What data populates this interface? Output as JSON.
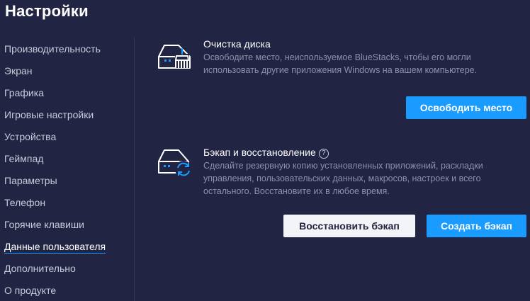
{
  "page_title": "Настройки",
  "sidebar": {
    "items": [
      {
        "label": "Производительность",
        "active": false
      },
      {
        "label": "Экран",
        "active": false
      },
      {
        "label": "Графика",
        "active": false
      },
      {
        "label": "Игровые настройки",
        "active": false
      },
      {
        "label": "Устройства",
        "active": false
      },
      {
        "label": "Геймпад",
        "active": false
      },
      {
        "label": "Параметры",
        "active": false
      },
      {
        "label": "Телефон",
        "active": false
      },
      {
        "label": "Горячие клавиши",
        "active": false
      },
      {
        "label": "Данные пользователя",
        "active": true
      },
      {
        "label": "Дополнительно",
        "active": false
      },
      {
        "label": "О продукте",
        "active": false
      }
    ]
  },
  "disk_cleanup": {
    "icon": "disk-cleanup-icon",
    "title": "Очистка диска",
    "description": "Освободите место, неиспользуемое BlueStacks, чтобы его могли использовать другие приложения Windows на вашем компьютере.",
    "button_label": "Освободить место"
  },
  "backup": {
    "icon": "backup-restore-icon",
    "title": "Бэкап и восстановление",
    "help_glyph": "?",
    "description": "Сделайте резервную копию установленных приложений, раскладки управления, пользовательских данных, макросов, настроек и всего остального. Восстановите их в любое время.",
    "restore_label": "Восстановить бэкап",
    "create_label": "Создать бэкап"
  },
  "colors": {
    "background": "#222443",
    "accent": "#1a9bff",
    "text_muted": "#8e90ac"
  }
}
